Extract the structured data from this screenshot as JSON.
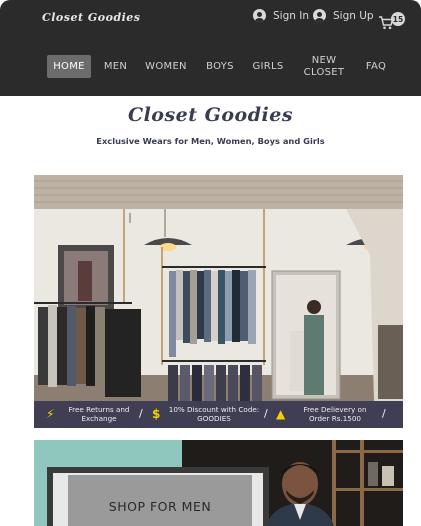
{
  "header": {
    "brand": "Closet Goodies",
    "sign_in": "Sign In",
    "sign_up": "Sign Up",
    "cart_count": "15",
    "icons": {
      "user": "user-icon",
      "cart": "cart-icon"
    }
  },
  "nav": {
    "home": "HOME",
    "men": "MEN",
    "women": "WOMEN",
    "boys": "BOYS",
    "girls": "GIRLS",
    "new_closet_line1": "NEW",
    "new_closet_line2": "CLOSET",
    "faq": "FAQ"
  },
  "hero": {
    "title": "Closet Goodies",
    "subtitle": "Exclusive Wears for Men, Women, Boys and Girls"
  },
  "promo": {
    "returns_line1": "Free Returns and",
    "returns_line2": "Exchange",
    "discount_line1": "10% Discount with Code:",
    "discount_line2": "GOODIES",
    "delivery_line1": "Free Delievery on",
    "delivery_line2": "Order Rs.1500",
    "sep": "/",
    "icons": {
      "returns": "lightning-icon",
      "discount": "dollar-icon",
      "delivery": "warning-icon"
    }
  },
  "shop": {
    "men_label": "SHOP FOR MEN"
  },
  "colors": {
    "header_bg": "#2b2b2b",
    "nav_active": "#6c6c6c",
    "title_color": "#3a3d52",
    "promo_bg": "#3f3e52",
    "promo_icon": "#f2d200",
    "teal": "#8fc6bd"
  }
}
